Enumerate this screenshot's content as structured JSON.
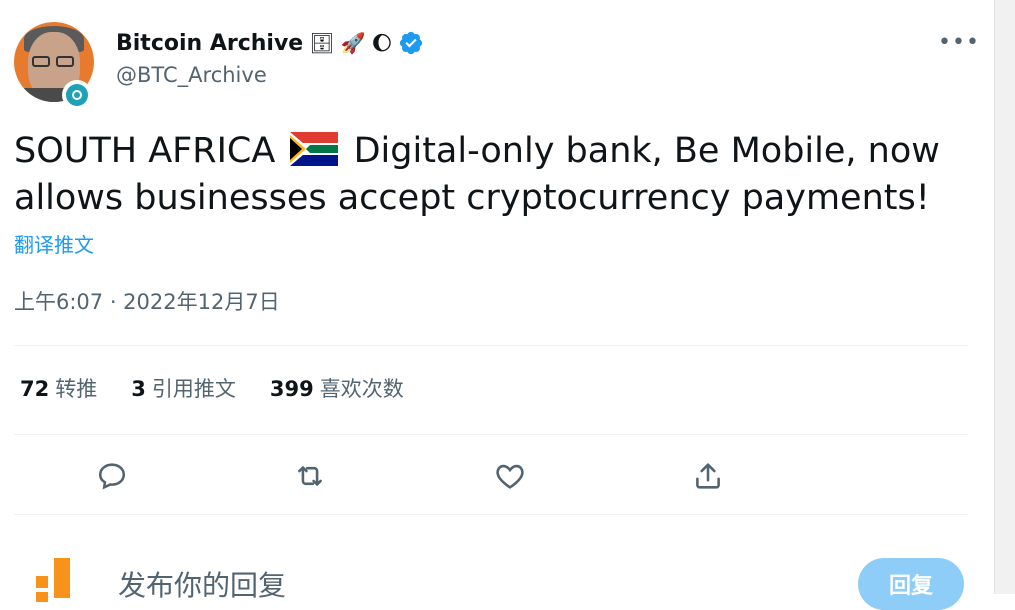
{
  "author": {
    "display_name": "Bitcoin Archive",
    "handle": "@BTC_Archive",
    "emojis": [
      "🗄",
      "🚀",
      "🌔"
    ]
  },
  "menu_icon": "more-dots-icon",
  "tweet": {
    "text_before_flag": "SOUTH AFRICA",
    "text_after_flag": "Digital-only bank, Be Mobile, now allows businesses accept cryptocurrency payments!",
    "translate_label": "翻译推文",
    "timestamp": "上午6:07 · 2022年12月7日"
  },
  "stats": {
    "retweets_count": "72",
    "retweets_label": "转推",
    "quotes_count": "3",
    "quotes_label": "引用推文",
    "likes_count": "399",
    "likes_label": "喜欢次数"
  },
  "actions": [
    "reply-icon",
    "retweet-icon",
    "like-icon",
    "share-icon"
  ],
  "reply": {
    "placeholder": "发布你的回复",
    "button_label": "回复"
  },
  "colors": {
    "accent": "#1d9bf0",
    "text_primary": "#0f1419",
    "text_secondary": "#536471",
    "divider": "#eff3f4",
    "reply_button": "#8ecdf8"
  }
}
